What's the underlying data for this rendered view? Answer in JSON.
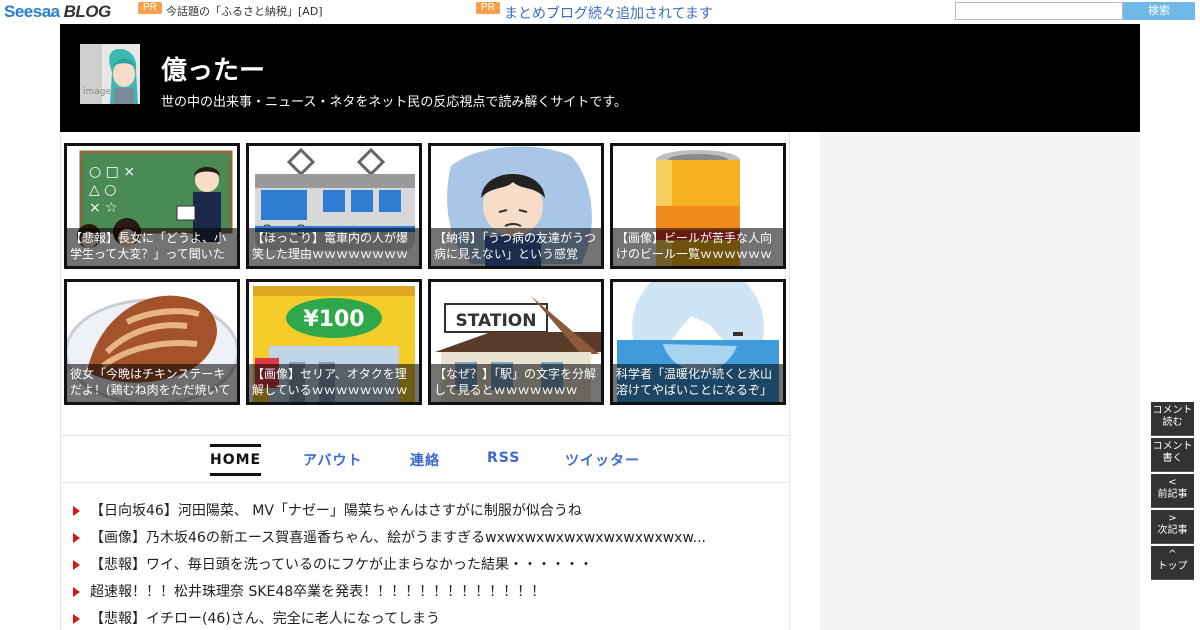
{
  "topbar": {
    "logo_seesaa": "Seesaa",
    "logo_blog": "BLOG",
    "pr_label": "PR",
    "ad1_text": "今話題の「ふるさと納税」[AD]",
    "ad2_text": "まとめブログ続々追加されてます",
    "search_placeholder": "",
    "search_button": "検索"
  },
  "header": {
    "avatar_text": "image",
    "title": "億ったー",
    "description": "世の中の出来事・ニュース・ネタをネット民の反応視点で読み解くサイトです。"
  },
  "thumbnails": [
    {
      "caption": "【悲報】長女に「どうよ、小学生って大変？」って聞いた"
    },
    {
      "caption": "【ほっこり】電車内の人が爆笑した理由ｗｗｗｗｗｗｗｗ"
    },
    {
      "caption": "【納得】「うつ病の友達がうつ病に見えない」という感覚"
    },
    {
      "caption": "【画像】ビールが苦手な人向けのビール一覧ｗｗｗｗｗｗ"
    },
    {
      "caption": "彼女「今晩はチキンステーキだよ！(鶏むね肉をただ焼いて"
    },
    {
      "caption": "【画像】セリア、オタクを理解しているｗｗｗｗｗｗｗｗ"
    },
    {
      "caption": "【なぜ？】「駅」の文字を分解して見るとｗｗｗｗｗｗｗ"
    },
    {
      "caption": "科学者「温暖化が続くと氷山溶けてやばいことになるぞ」"
    }
  ],
  "thumb_art": {
    "t1_board_symbols": "○ □ ×\n△ ○ ×\n× ☆",
    "t6_price": "¥100",
    "t7_sign": "STATION"
  },
  "nav": {
    "home": "HOME",
    "about": "アバウト",
    "contact": "連絡",
    "rss": "RSS",
    "twitter": "ツイッター"
  },
  "posts": [
    "【日向坂46】河田陽菜、 MV「ナゼー」陽菜ちゃんはさすがに制服が似合うね",
    "【画像】乃木坂46の新エース賀喜遥香ちゃん、絵がうますぎるwxwxwxwxwxwxwxwxwxwxw...",
    "【悲報】ワイ、毎日頭を洗っているのにフケが止まらなかった結果・・・・・・",
    "超速報！！！松井珠理奈 SKE48卒業を発表！！！！！！！！！！！！！",
    "【悲報】イチロー(46)さん、完全に老人になってしまう"
  ],
  "side_buttons": [
    {
      "line1": "コメント",
      "line2": "読む"
    },
    {
      "line1": "コメント",
      "line2": "書く"
    },
    {
      "line1": "<",
      "line2": "前記事"
    },
    {
      "line1": ">",
      "line2": "次記事"
    },
    {
      "line1": "^",
      "line2": "トップ"
    }
  ],
  "colors": {
    "header_bg": "#000000",
    "nav_link": "#3b6bd1",
    "post_arrow": "#d01a1a",
    "search_button": "#6fb8e8",
    "pr_badge": "#f5a04a"
  }
}
